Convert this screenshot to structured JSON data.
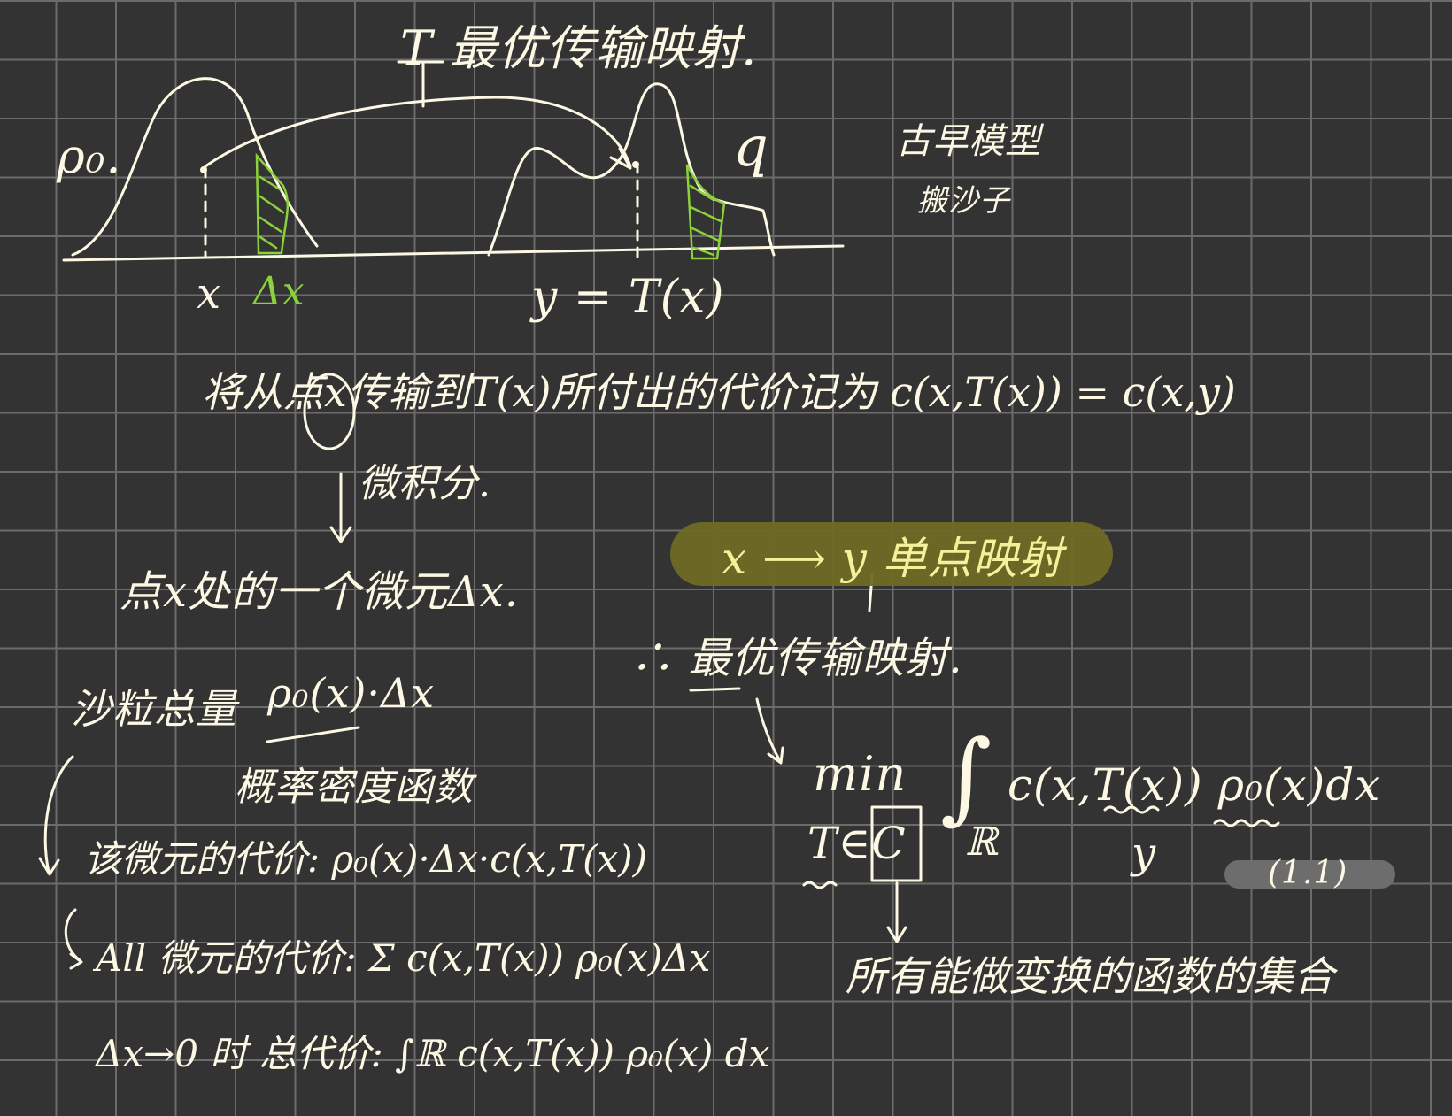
{
  "colors": {
    "board": "#333333",
    "grid": "#6b6b6b",
    "ink": "#fdf8e4",
    "accent_green": "#8bd23a",
    "highlight": "#6f6a25"
  },
  "figure": {
    "label_rho": "ρ₀.",
    "label_q": "q",
    "label_x": "x",
    "label_dx": "Δx",
    "label_y": "y = T(x)",
    "map_title": "T 最优传输映射."
  },
  "side_note": {
    "line1": "古早模型",
    "line2": "搬沙子"
  },
  "left": {
    "statement": "将从点x传输到T(x)所付出的代价记为 c(x,T(x)) = c(x,y)",
    "calculus": "微积分.",
    "micro_element": "点x处的一个微元Δx.",
    "sand_label": "沙粒总量",
    "sand_expr": "ρ₀(x)·Δx",
    "density": "概率密度函数",
    "cost_element": "该微元的代价: ρ₀(x)·Δx·c(x,T(x))",
    "cost_all": "All 微元的代价: Σ c(x,T(x)) ρ₀(x)Δx",
    "cost_total": "Δx→0 时 总代价: ∫ℝ c(x,T(x)) ρ₀(x) dx"
  },
  "right": {
    "single_point": "x ⟶ y 单点映射",
    "therefore": "∴ 最优传输映射.",
    "min": "min",
    "subscript": "T∈C",
    "integral": "∫",
    "domain": "ℝ",
    "integrand": "c(x,T(x)) ρ₀(x)dx",
    "y_under": "y",
    "eq_number": "(1.1)",
    "set_note": "所有能做变换的函数的集合"
  }
}
